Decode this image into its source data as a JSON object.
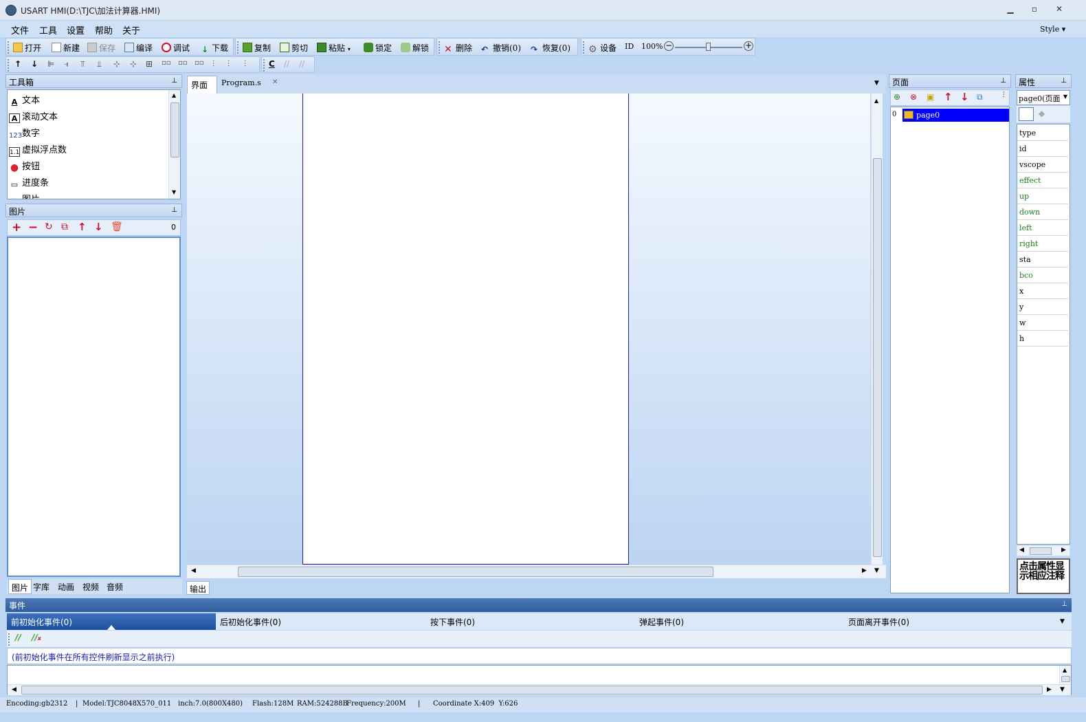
{
  "window": {
    "title": "USART HMI(D:\\TJC\\加法计算器.HMI)",
    "min": "▁",
    "max": "▫",
    "close": "✕"
  },
  "menu": {
    "items": [
      "文件",
      "工具",
      "设置",
      "帮助",
      "关于"
    ],
    "style": "Style ▾"
  },
  "toolbar1": {
    "open": "打开",
    "new": "新建",
    "save": "保存",
    "compile": "编译",
    "debug": "调试",
    "download": "下载",
    "copy": "复制",
    "cut": "剪切",
    "paste": "粘贴",
    "lock": "锁定",
    "unlock": "解锁",
    "delete": "删除",
    "undo": "撤销(0)",
    "redo": "恢复(0)",
    "device": "设备",
    "id": "ID",
    "zoom": "100%"
  },
  "toolbox": {
    "title": "工具箱",
    "items": [
      {
        "icon": "A",
        "label": "文本"
      },
      {
        "icon": "A",
        "label": "滚动文本"
      },
      {
        "icon": "123",
        "label": "数字"
      },
      {
        "icon": "1.1",
        "label": "虚拟浮点数"
      },
      {
        "icon": "●",
        "label": "按钮"
      },
      {
        "icon": "▭",
        "label": "进度条"
      },
      {
        "icon": "▣",
        "label": "图片"
      }
    ]
  },
  "pictures": {
    "title": "图片",
    "count": "0"
  },
  "left_tabs": [
    "图片",
    "字库",
    "动画",
    "视频",
    "音频"
  ],
  "editor": {
    "tabs": [
      "界面",
      "Program.s"
    ],
    "close": "✕",
    "output_tab": "输出"
  },
  "pages": {
    "title": "页面",
    "items": [
      {
        "index": "0",
        "name": "page0"
      }
    ]
  },
  "props": {
    "title": "属性",
    "selector": "page0(页面",
    "rows": [
      {
        "name": "type",
        "color": "#000000"
      },
      {
        "name": "id",
        "color": "#000000"
      },
      {
        "name": "vscope",
        "color": "#000000"
      },
      {
        "name": "effect",
        "color": "#1b7c1b"
      },
      {
        "name": "up",
        "color": "#1b7c1b"
      },
      {
        "name": "down",
        "color": "#1b7c1b"
      },
      {
        "name": "left",
        "color": "#1b7c1b"
      },
      {
        "name": "right",
        "color": "#1b7c1b"
      },
      {
        "name": "sta",
        "color": "#000000"
      },
      {
        "name": "bco",
        "color": "#1b7c1b"
      },
      {
        "name": "x",
        "color": "#000000"
      },
      {
        "name": "y",
        "color": "#000000"
      },
      {
        "name": "w",
        "color": "#000000"
      },
      {
        "name": "h",
        "color": "#000000"
      }
    ],
    "note": "点击属性显示相应注释"
  },
  "events": {
    "title": "事件",
    "tabs": [
      "前初始化事件(0)",
      "后初始化事件(0)",
      "按下事件(0)",
      "弹起事件(0)",
      "页面离开事件(0)"
    ],
    "description": "(前初始化事件在所有控件刷新显示之前执行)"
  },
  "status": {
    "encoding": "Encoding:gb2312",
    "model": "Model:TJC8048X570_011",
    "inch": "inch:7.0(800X480)",
    "flash": "Flash:128M",
    "ram": "RAM:524288B",
    "freq": "Frequency:200M",
    "coord": "Coordinate X:409  Y:626"
  },
  "colors": {
    "accent": "#1a5fb4",
    "selection": "#0000ff",
    "delete_red": "#c8102e"
  }
}
